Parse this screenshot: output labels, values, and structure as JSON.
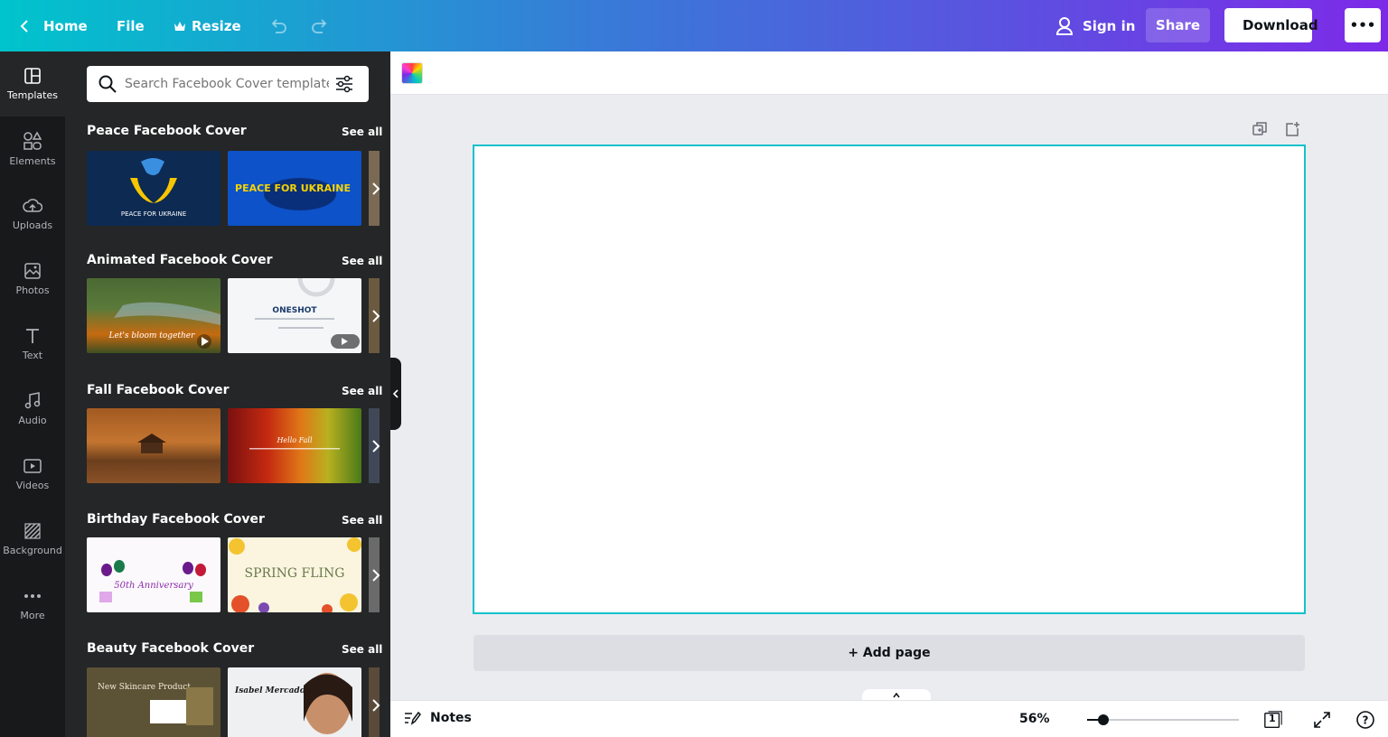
{
  "topbar": {
    "home_label": "Home",
    "file_label": "File",
    "resize_label": "Resize",
    "signin_label": "Sign in",
    "share_label": "Share",
    "download_label": "Download",
    "more_label": "•••"
  },
  "rail": [
    {
      "label": "Templates",
      "icon": "templates-icon"
    },
    {
      "label": "Elements",
      "icon": "elements-icon"
    },
    {
      "label": "Uploads",
      "icon": "uploads-icon"
    },
    {
      "label": "Photos",
      "icon": "photos-icon"
    },
    {
      "label": "Text",
      "icon": "text-icon"
    },
    {
      "label": "Audio",
      "icon": "audio-icon"
    },
    {
      "label": "Videos",
      "icon": "videos-icon"
    },
    {
      "label": "Background",
      "icon": "background-icon"
    },
    {
      "label": "More",
      "icon": "more-icon"
    }
  ],
  "search": {
    "placeholder": "Search Facebook Cover templates"
  },
  "see_all_label": "See all",
  "sections": [
    {
      "title": "Peace Facebook Cover",
      "thumbs": [
        {
          "caption": "PEACE FOR UKRAINE"
        },
        {
          "caption": "PEACE FOR UKRAINE"
        }
      ]
    },
    {
      "title": "Animated Facebook Cover",
      "thumbs": [
        {
          "caption": "Let's bloom together"
        },
        {
          "caption": "ONESHOT"
        }
      ]
    },
    {
      "title": "Fall Facebook Cover",
      "thumbs": [
        {
          "caption": ""
        },
        {
          "caption": "Hello Fall"
        }
      ]
    },
    {
      "title": "Birthday Facebook Cover",
      "thumbs": [
        {
          "caption": "50th Anniversary"
        },
        {
          "caption": "SPRING FLING"
        }
      ]
    },
    {
      "title": "Beauty Facebook Cover",
      "thumbs": [
        {
          "caption": "New Skincare Product"
        },
        {
          "caption": "Isabel Mercado"
        }
      ]
    }
  ],
  "canvas": {
    "add_page_label": "+ Add page"
  },
  "bottombar": {
    "notes_label": "Notes",
    "zoom_label": "56%",
    "zoom_level_percent": 56,
    "page_count": "1",
    "help_label": "?"
  },
  "colors": {
    "accent": "#13c2cc",
    "brand_start": "#00c4cc",
    "brand_end": "#7d2ae8",
    "panel": "#252627",
    "rail": "#18191b"
  }
}
